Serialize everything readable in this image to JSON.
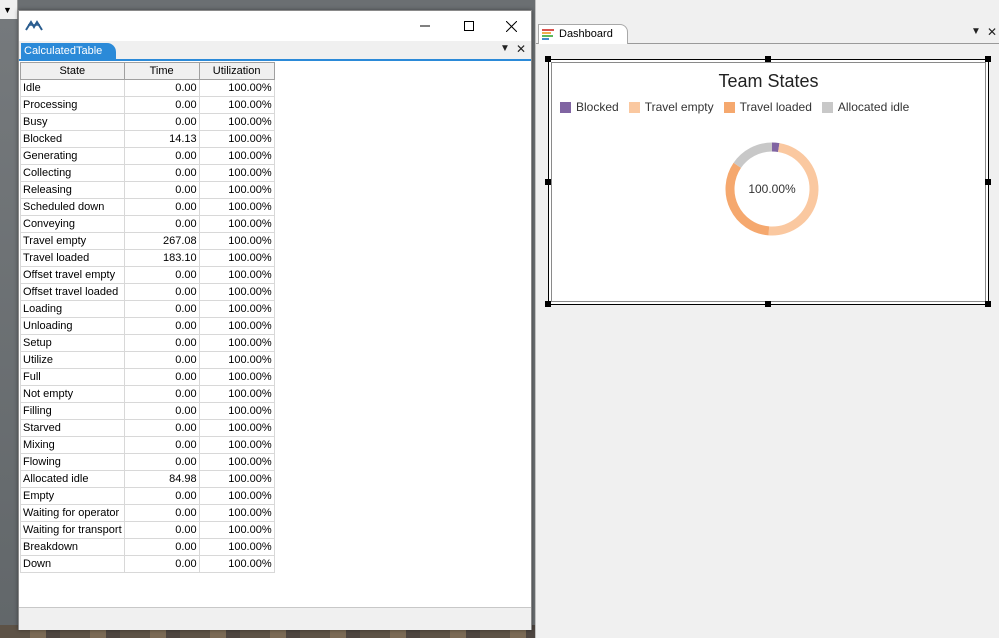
{
  "table_window": {
    "tab_label": "CalculatedTable",
    "columns": [
      "State",
      "Time",
      "Utilization"
    ],
    "rows": [
      {
        "state": "Idle",
        "time": "0.00",
        "util": "100.00%"
      },
      {
        "state": "Processing",
        "time": "0.00",
        "util": "100.00%"
      },
      {
        "state": "Busy",
        "time": "0.00",
        "util": "100.00%"
      },
      {
        "state": "Blocked",
        "time": "14.13",
        "util": "100.00%"
      },
      {
        "state": "Generating",
        "time": "0.00",
        "util": "100.00%"
      },
      {
        "state": "Collecting",
        "time": "0.00",
        "util": "100.00%"
      },
      {
        "state": "Releasing",
        "time": "0.00",
        "util": "100.00%"
      },
      {
        "state": "Scheduled down",
        "time": "0.00",
        "util": "100.00%"
      },
      {
        "state": "Conveying",
        "time": "0.00",
        "util": "100.00%"
      },
      {
        "state": "Travel empty",
        "time": "267.08",
        "util": "100.00%"
      },
      {
        "state": "Travel loaded",
        "time": "183.10",
        "util": "100.00%"
      },
      {
        "state": "Offset travel empty",
        "time": "0.00",
        "util": "100.00%"
      },
      {
        "state": "Offset travel loaded",
        "time": "0.00",
        "util": "100.00%"
      },
      {
        "state": "Loading",
        "time": "0.00",
        "util": "100.00%"
      },
      {
        "state": "Unloading",
        "time": "0.00",
        "util": "100.00%"
      },
      {
        "state": "Setup",
        "time": "0.00",
        "util": "100.00%"
      },
      {
        "state": "Utilize",
        "time": "0.00",
        "util": "100.00%"
      },
      {
        "state": "Full",
        "time": "0.00",
        "util": "100.00%"
      },
      {
        "state": "Not empty",
        "time": "0.00",
        "util": "100.00%"
      },
      {
        "state": "Filling",
        "time": "0.00",
        "util": "100.00%"
      },
      {
        "state": "Starved",
        "time": "0.00",
        "util": "100.00%"
      },
      {
        "state": "Mixing",
        "time": "0.00",
        "util": "100.00%"
      },
      {
        "state": "Flowing",
        "time": "0.00",
        "util": "100.00%"
      },
      {
        "state": "Allocated idle",
        "time": "84.98",
        "util": "100.00%"
      },
      {
        "state": "Empty",
        "time": "0.00",
        "util": "100.00%"
      },
      {
        "state": "Waiting for operator",
        "time": "0.00",
        "util": "100.00%"
      },
      {
        "state": "Waiting for transport",
        "time": "0.00",
        "util": "100.00%"
      },
      {
        "state": "Breakdown",
        "time": "0.00",
        "util": "100.00%"
      },
      {
        "state": "Down",
        "time": "0.00",
        "util": "100.00%"
      }
    ]
  },
  "dashboard": {
    "tab_label": "Dashboard"
  },
  "chart_data": {
    "type": "pie",
    "title": "Team States",
    "center_label": "100.00%",
    "categories": [
      "Blocked",
      "Travel empty",
      "Travel loaded",
      "Allocated idle"
    ],
    "values": [
      14.13,
      267.08,
      183.1,
      84.98
    ],
    "colors": [
      "#8064a2",
      "#fac8a0",
      "#f5a86e",
      "#c8c8c8"
    ],
    "legend_position": "top-left"
  }
}
